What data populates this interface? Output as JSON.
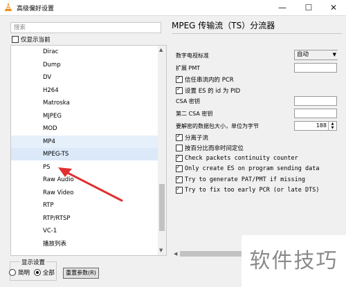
{
  "window": {
    "title": "高级偏好设置",
    "minimize": "—",
    "maximize": "☐",
    "close": "✕"
  },
  "search": {
    "placeholder": "搜索"
  },
  "only_current": {
    "label": "仅显示当前",
    "checked": false
  },
  "tree_items": [
    "Dirac",
    "Dump",
    "DV",
    "H264",
    "Matroska",
    "MJPEG",
    "MOD",
    "MP4",
    "MPEG-TS",
    "PS",
    "Raw Audio",
    "Raw Video",
    "RTP",
    "RTP/RTSP",
    "VC-1",
    "播放列表"
  ],
  "tree_selected": "MPEG-TS",
  "display_settings": {
    "legend": "显示设置",
    "simple": "简明",
    "all": "全部",
    "selected": "all"
  },
  "reset_button": "重置参数(R)",
  "panel": {
    "title": "MPEG 传输流（TS）分流器",
    "digital_tv_standard_label": "数字电视标准",
    "digital_tv_standard_value": "自动",
    "extra_pmt_label": "扩展 PMT",
    "trust_pcr_label": "信任串流内的 PCR",
    "trust_pcr_checked": true,
    "es_id_pid_label": "设置 ES 的 id 为 PID",
    "es_id_pid_checked": true,
    "csa_key_label": "CSA 密钥",
    "csa2_key_label": "第二 CSA 密钥",
    "packet_size_label": "要解密的数据包大小，单位为字节",
    "packet_size_value": "188",
    "separate_sub_label": "分离子流",
    "separate_sub_checked": true,
    "seek_percent_label": "按百分比而非时间定位",
    "seek_percent_checked": false,
    "check_cc_label": "Check packets continuity counter",
    "check_cc_checked": true,
    "only_es_label": "Only create ES on program sending data",
    "only_es_checked": true,
    "gen_pat_label": "Try to generate PAT/PMT if missing",
    "gen_pat_checked": true,
    "fix_pcr_label": "Try to fix too early PCR (or late DTS)",
    "fix_pcr_checked": true
  },
  "watermark": "软件技巧",
  "colors": {
    "selection": "#dbe9f8",
    "arrow": "#e02f2f",
    "window_bg": "#f0f0f0"
  }
}
